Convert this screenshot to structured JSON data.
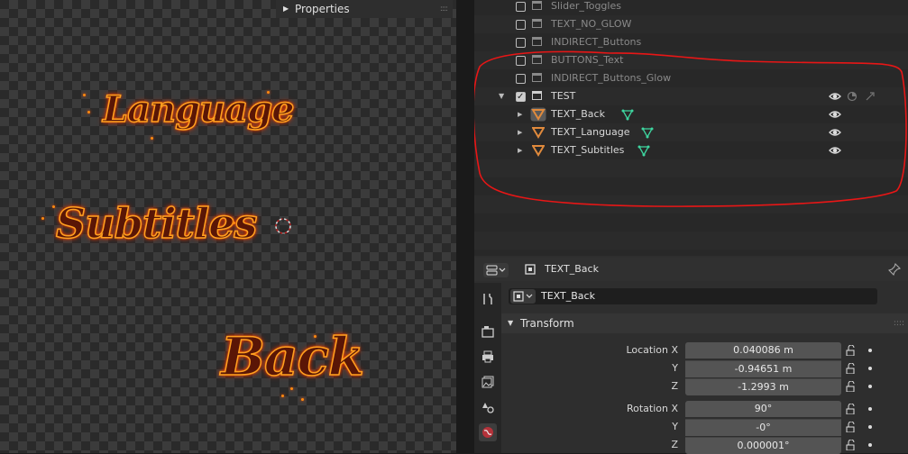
{
  "viewport": {
    "panel_label": "Properties",
    "texts": {
      "language": "Language",
      "subtitles": "Subtitles",
      "back": "Back"
    }
  },
  "outliner": {
    "rows": [
      {
        "name": "Slider_Toggles",
        "checked": false
      },
      {
        "name": "TEXT_NO_GLOW",
        "checked": false
      },
      {
        "name": "INDIRECT_Buttons",
        "checked": false
      },
      {
        "name": "BUTTONS_Text",
        "checked": false
      },
      {
        "name": "INDIRECT_Buttons_Glow",
        "checked": false
      },
      {
        "name": "TEST",
        "checked": true
      },
      {
        "name": "TEXT_Back"
      },
      {
        "name": "TEXT_Language"
      },
      {
        "name": "TEXT_Subtitles"
      }
    ]
  },
  "properties": {
    "header_title": "TEXT_Back",
    "object_name": "TEXT_Back",
    "transform_label": "Transform",
    "location": {
      "label_x": "Location X",
      "label_y": "Y",
      "label_z": "Z",
      "x": "0.040086 m",
      "y": "-0.94651 m",
      "z": "-1.2993 m"
    },
    "rotation": {
      "label_x": "Rotation X",
      "label_y": "Y",
      "label_z": "Z",
      "x": "90°",
      "y": "-0°",
      "z": "0.000001°"
    }
  },
  "colors": {
    "accent_orange": "#e08a3c",
    "modifier_green": "#3ed6a0",
    "highlight_red": "#e81616"
  }
}
